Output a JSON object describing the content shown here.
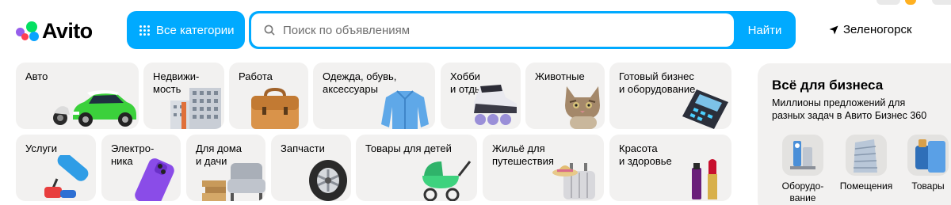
{
  "header": {
    "logo_text": "Avito",
    "categories_button": "Все категории",
    "search": {
      "placeholder": "Поиск по объявлениям",
      "value": "",
      "button": "Найти"
    },
    "location": "Зеленогорск"
  },
  "categories": {
    "row1": [
      {
        "label": "Авто",
        "icon": "car-image"
      },
      {
        "label": "Недвижи-\nмость",
        "icon": "buildings-image"
      },
      {
        "label": "Работа",
        "icon": "briefcase-image"
      },
      {
        "label": "Одежда, обувь,\nаксессуары",
        "icon": "jacket-image"
      },
      {
        "label": "Хобби\nи отдых",
        "icon": "roller-skate-image"
      },
      {
        "label": "Животные",
        "icon": "cat-image"
      },
      {
        "label": "Готовый бизнес\nи оборудование",
        "icon": "payment-terminal-image"
      }
    ],
    "row2": [
      {
        "label": "Услуги",
        "icon": "paint-roller-image"
      },
      {
        "label": "Электро-\nника",
        "icon": "smartphone-image"
      },
      {
        "label": "Для дома\nи дачи",
        "icon": "armchair-image"
      },
      {
        "label": "Запчасти",
        "icon": "wheel-image"
      },
      {
        "label": "Товары для детей",
        "icon": "stroller-image"
      },
      {
        "label": "Жильё для\nпутешествия",
        "icon": "suitcase-image"
      },
      {
        "label": "Красота\nи здоровье",
        "icon": "lipstick-image"
      }
    ]
  },
  "business": {
    "title": "Всё для бизнеса",
    "subtitle": "Миллионы предложений для разных задач в Авито Бизнес 360",
    "items": [
      {
        "label": "Оборудо-\nвание",
        "icon": "equipment-icon"
      },
      {
        "label": "Помещения",
        "icon": "premises-icon"
      },
      {
        "label": "Товары",
        "icon": "goods-icon"
      }
    ]
  },
  "colors": {
    "accent": "#00aaff",
    "tile_bg": "#f2f1f0",
    "logo_green": "#04e061",
    "logo_blue": "#0aa3ff",
    "logo_purple": "#965eeb",
    "logo_red": "#ff4053"
  }
}
